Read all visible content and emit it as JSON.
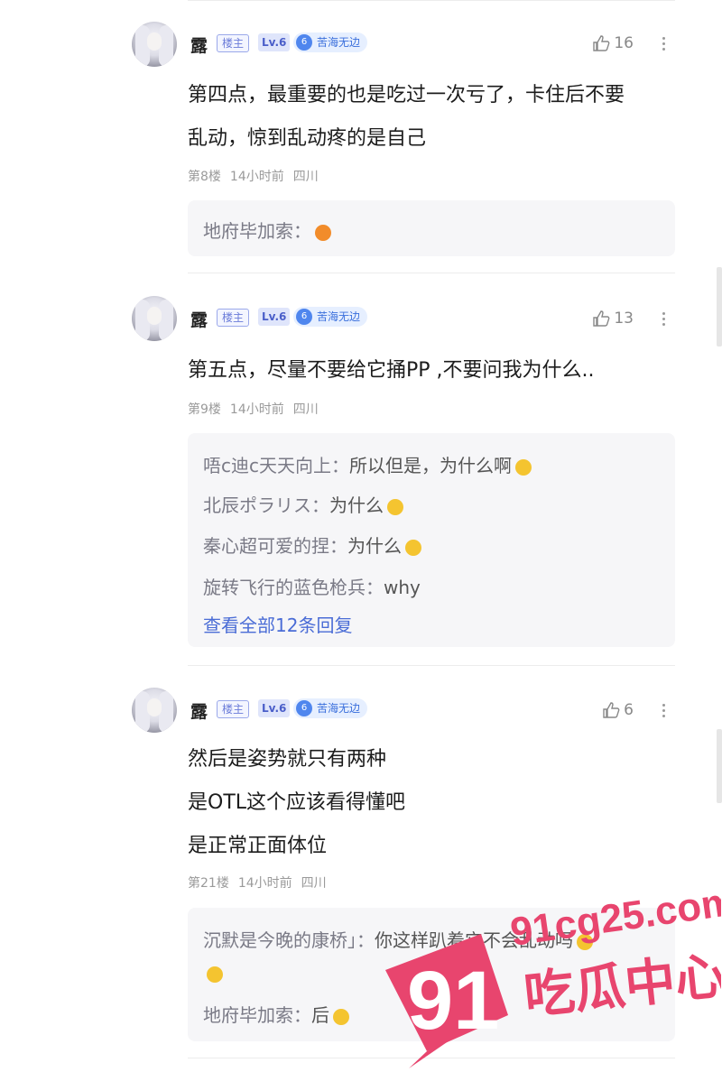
{
  "posts": [
    {
      "user": {
        "name": "露",
        "host_badge": "楼主",
        "level": "Lv.6",
        "title_num": "6",
        "title": "苦海无边"
      },
      "likes": "16",
      "content": [
        "第四点，最重要的也是吃过一次亏了，卡住后不要",
        "乱动，惊到乱动疼的是自己"
      ],
      "meta": {
        "floor": "第8楼",
        "time": "14小时前",
        "location": "四川"
      },
      "replies": [
        {
          "author": "地府毕加索：",
          "text": ""
        }
      ]
    },
    {
      "user": {
        "name": "露",
        "host_badge": "楼主",
        "level": "Lv.6",
        "title_num": "6",
        "title": "苦海无边"
      },
      "likes": "13",
      "content": [
        "第五点，尽量不要给它捅PP ,不要问我为什么.."
      ],
      "meta": {
        "floor": "第9楼",
        "time": "14小时前",
        "location": "四川"
      },
      "replies": [
        {
          "author": "唔c迪c天天向上：",
          "text": "所以但是，为什么啊"
        },
        {
          "author": "北辰ポラリス：",
          "text": "为什么"
        },
        {
          "author": "秦心超可爱的捏：",
          "text": "为什么"
        },
        {
          "author": "旋转飞行的蓝色枪兵：",
          "text": "why"
        }
      ],
      "view_all": "查看全部12条回复"
    },
    {
      "user": {
        "name": "露",
        "host_badge": "楼主",
        "level": "Lv.6",
        "title_num": "6",
        "title": "苦海无边"
      },
      "likes": "6",
      "content": [
        "然后是姿势就只有两种",
        "是OTL这个应该看得懂吧",
        "是正常正面体位"
      ],
      "meta": {
        "floor": "第21楼",
        "time": "14小时前",
        "location": "四川"
      },
      "replies": [
        {
          "author": "沉默是今晚的康桥」：",
          "text": "你这样趴着它不会乱动吗"
        },
        {
          "author": "地府毕加索：",
          "text": "后"
        }
      ]
    }
  ],
  "watermark": {
    "number": "91",
    "domain": "91cg25.com",
    "brand": "吃瓜中心",
    "color": "#e8456e"
  }
}
